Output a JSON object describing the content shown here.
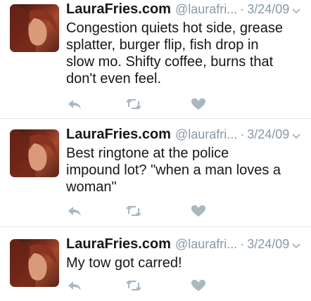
{
  "colors": {
    "text": "#14171a",
    "muted": "#8899a6",
    "icon": "#aab8c2",
    "divider": "#e1e8ed"
  },
  "tweets": [
    {
      "name": "LauraFries.com",
      "handle": "@laurafri...",
      "separator": "·",
      "date": "3/24/09",
      "lines": [
        "Congestion quiets hot side, grease",
        "splatter, burger flip, fish drop in",
        "slow mo. Shifty coffee, burns that",
        "don't even feel."
      ],
      "icons": [
        "reply-icon",
        "retweet-icon",
        "like-icon"
      ]
    },
    {
      "name": "LauraFries.com",
      "handle": "@laurafri...",
      "separator": "·",
      "date": "3/24/09",
      "lines": [
        "Best ringtone at the police",
        "impound lot? \"when a man loves a",
        "woman\""
      ],
      "icons": [
        "reply-icon",
        "retweet-icon",
        "like-icon"
      ]
    },
    {
      "name": "LauraFries.com",
      "handle": "@laurafri...",
      "separator": "·",
      "date": "3/24/09",
      "lines": [
        "My tow got carred!"
      ],
      "icons": [
        "reply-icon",
        "retweet-icon",
        "like-icon"
      ]
    }
  ]
}
